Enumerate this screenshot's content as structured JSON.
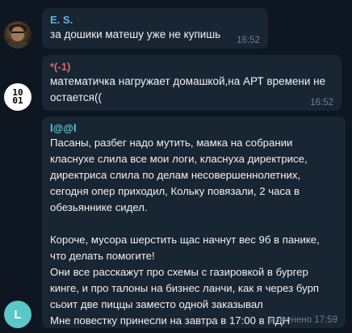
{
  "colors": {
    "background": "#0e1621",
    "bubble": "#182533",
    "time": "#6d7f8f",
    "sender1": "#5fb2e8",
    "sender2": "#e06a6a",
    "sender3": "#5fc8d6",
    "letter_avatar": "#5ac8c8"
  },
  "messages": [
    {
      "sender": "E. S.",
      "text": "за дошики матешу уже не купишь",
      "time": "16:52",
      "avatar": {
        "type": "photo",
        "icon": "user-photo-avatar"
      }
    },
    {
      "sender": "*(-1)",
      "text": "математичка нагружает домашкой,на АРТ времени не остается((",
      "time": "16:52",
      "avatar": {
        "type": "binary",
        "rows": [
          "10",
          "01"
        ],
        "icon": "binary-avatar"
      }
    },
    {
      "sender": "l@@l",
      "text": "Пасаны, разбег надо мутить, мамка на собрании\nкласнухе слила все мои логи, класнуха директрисе,\nдиректриса слила по делам несовершеннолетних,\nсегодня опер приходил, Кольку повязали, 2 часа в\nобезьяннике сидел.\n\nКороче, мусора шерстить щас начнут вес 9б в панике,\nчто делать помогите!\nОни все расскажут про схемы с газировкой в бургер\nкинге, и про талоны на бизнес ланчи, как я через бурп\nсьоит две пиццы заместо одной заказывал\nМне повестку принесли на завтра в 17:00 в ПДН",
      "time": "изменено 17:59",
      "avatar": {
        "type": "letter",
        "letter": "L",
        "icon": "letter-avatar"
      }
    }
  ]
}
